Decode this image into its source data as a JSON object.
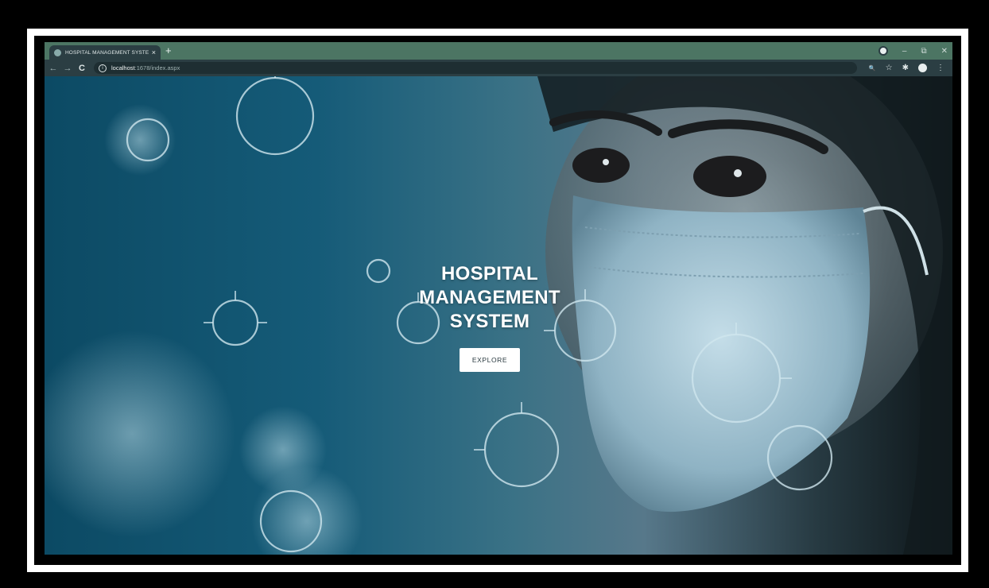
{
  "browser": {
    "tab_title": "HOSPITAL MANAGEMENT SYSTEM",
    "tab_close": "×",
    "new_tab": "+",
    "window_controls": {
      "minimize": "–",
      "maximize": "⧉",
      "close": "✕"
    },
    "nav": {
      "back": "←",
      "forward": "→",
      "reload": "C"
    },
    "url_host": "localhost",
    "url_path": ":1678/index.aspx",
    "tools": {
      "zoom": "🔍",
      "star": "☆",
      "extensions": "✱"
    }
  },
  "hero": {
    "title_line1": "HOSPITAL",
    "title_line2": "MANAGEMENT",
    "title_line3": "SYSTEM",
    "button_label": "EXPLORE"
  },
  "colors": {
    "tabstrip": "#4c7563",
    "toolbar": "#2b3e43",
    "hero_left": "#0c4a64",
    "hero_right": "#0d1518",
    "button_bg": "#ffffff"
  },
  "icons": [
    "favicon-icon",
    "close-icon",
    "plus-icon",
    "back-icon",
    "forward-icon",
    "reload-icon",
    "info-icon",
    "zoom-icon",
    "star-icon",
    "extensions-icon",
    "account-icon",
    "profile-icon",
    "minimize-icon",
    "maximize-icon",
    "window-close-icon",
    "virus-icon"
  ]
}
